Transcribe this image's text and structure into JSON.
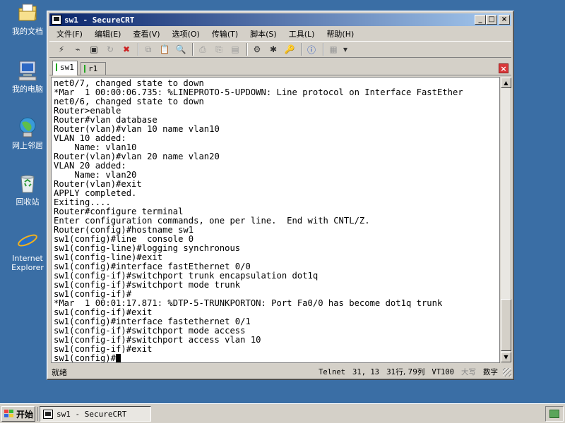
{
  "desktop": {
    "icons": [
      {
        "label": "我的文档",
        "icon": "folder-documents-icon"
      },
      {
        "label": "我的电脑",
        "icon": "computer-icon"
      },
      {
        "label": "网上邻居",
        "icon": "network-icon"
      },
      {
        "label": "回收站",
        "icon": "recycle-bin-icon"
      },
      {
        "label": "Internet\nExplorer",
        "icon": "ie-icon"
      }
    ]
  },
  "window": {
    "title": "sw1 - SecureCRT",
    "controls": {
      "minimize": "_",
      "maximize": "□",
      "close": "×"
    }
  },
  "menu": [
    "文件(F)",
    "编辑(E)",
    "查看(V)",
    "选项(O)",
    "传输(T)",
    "脚本(S)",
    "工具(L)",
    "帮助(H)"
  ],
  "tabs": [
    {
      "label": "sw1",
      "active": true
    },
    {
      "label": "r1",
      "active": false
    }
  ],
  "terminal": {
    "lines": [
      "net0/7, changed state to down",
      "*Mar  1 00:00:06.735: %LINEPROTO-5-UPDOWN: Line protocol on Interface FastEther",
      "net0/6, changed state to down",
      "Router>enable",
      "Router#vlan database",
      "Router(vlan)#vlan 10 name vlan10",
      "VLAN 10 added:",
      "    Name: vlan10",
      "Router(vlan)#vlan 20 name vlan20",
      "VLAN 20 added:",
      "    Name: vlan20",
      "Router(vlan)#exit",
      "APPLY completed.",
      "Exiting....",
      "Router#configure terminal",
      "Enter configuration commands, one per line.  End with CNTL/Z.",
      "Router(config)#hostname sw1",
      "sw1(config)#line  console 0",
      "sw1(config-line)#logging synchronous",
      "sw1(config-line)#exit",
      "sw1(config)#interface fastEthernet 0/0",
      "sw1(config-if)#switchport trunk encapsulation dot1q",
      "sw1(config-if)#switchport mode trunk",
      "sw1(config-if)#",
      "*Mar  1 00:01:17.871: %DTP-5-TRUNKPORTON: Port Fa0/0 has become dot1q trunk",
      "sw1(config-if)#exit",
      "sw1(config)#interface fastethernet 0/1",
      "sw1(config-if)#switchport mode access",
      "sw1(config-if)#switchport access vlan 10",
      "sw1(config-if)#exit"
    ],
    "prompt": "sw1(config)#"
  },
  "status": {
    "ready": "就绪",
    "protocol": "Telnet",
    "position": "31,  13",
    "rowcol": "31行, 79列",
    "terminal_type": "VT100",
    "caps": "大写",
    "num": "数字"
  },
  "taskbar": {
    "start_label": "开始",
    "task_label": "sw1 - SecureCRT"
  }
}
